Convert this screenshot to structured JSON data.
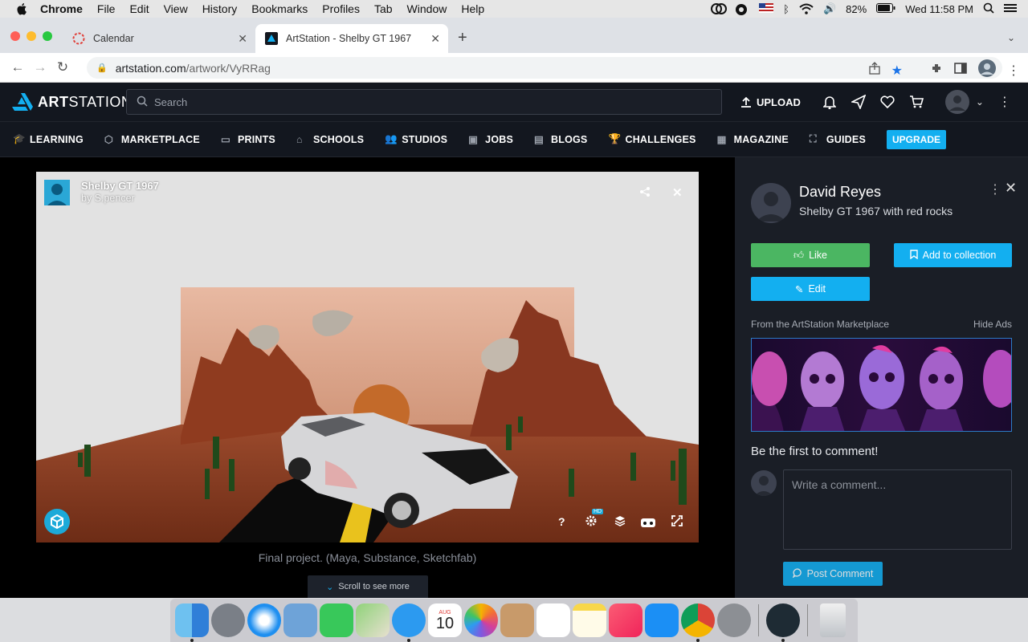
{
  "menubar": {
    "app": "Chrome",
    "items": [
      "File",
      "Edit",
      "View",
      "History",
      "Bookmarks",
      "Profiles",
      "Tab",
      "Window",
      "Help"
    ],
    "battery": "82%",
    "clock": "Wed 11:58 PM"
  },
  "tabs": [
    {
      "title": "Calendar",
      "active": false
    },
    {
      "title": "ArtStation - Shelby GT 1967",
      "active": true
    }
  ],
  "address": {
    "host": "artstation.com",
    "path": "/artwork/VyRRag"
  },
  "header": {
    "logo_bold": "ART",
    "logo_rest": "STATION",
    "search_placeholder": "Search",
    "upload_label": "UPLOAD"
  },
  "nav": {
    "items": [
      "LEARNING",
      "MARKETPLACE",
      "PRINTS",
      "SCHOOLS",
      "STUDIOS",
      "JOBS",
      "BLOGS",
      "CHALLENGES",
      "MAGAZINE",
      "GUIDES"
    ],
    "upgrade": "UPGRADE"
  },
  "viewer": {
    "title": "Shelby GT 1967",
    "by": "by S.pencer",
    "hd_badge": "HD",
    "caption": "Final project. (Maya, Substance, Sketchfab)",
    "scroll_more": "Scroll to see more"
  },
  "sidebar": {
    "artist": "David Reyes",
    "subtitle": "Shelby GT 1967 with red rocks",
    "like": "Like",
    "add_collection": "Add to collection",
    "edit": "Edit",
    "ad_label": "From the ArtStation Marketplace",
    "hide_ads": "Hide Ads",
    "first_comment": "Be the first to comment!",
    "comment_placeholder": "Write a comment...",
    "post_comment": "Post Comment"
  },
  "dock": {
    "calendar_month": "AUG",
    "calendar_day": "10"
  },
  "colors": {
    "accent": "#13aff0",
    "like": "#4bb662",
    "header_bg": "#13171f",
    "sidebar_bg": "#1a1e26"
  }
}
